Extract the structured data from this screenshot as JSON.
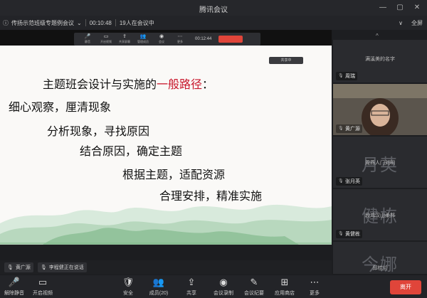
{
  "window": {
    "title": "腾讯会议"
  },
  "infobar": {
    "meeting_name": "传扬示范班级专题例会议",
    "duration": "00:10:48",
    "participants": "19人在会议中",
    "right_items": [
      "∨",
      "全屏"
    ]
  },
  "share": {
    "toolbar": {
      "buttons": [
        "静音",
        "开启视频",
        "共享屏幕",
        "管理成员",
        "会议",
        "更多"
      ],
      "timer": "00:12:44"
    },
    "view_tag": "共享中",
    "slide_lines": [
      {
        "pre": "主题班会设计与实施的",
        "hl": "一般路径",
        "post": "："
      },
      {
        "pre": "细心观察，厘清现象",
        "hl": "",
        "post": ""
      },
      {
        "pre": "分析现象，寻找原因",
        "hl": "",
        "post": ""
      },
      {
        "pre": "结合原因，确定主题",
        "hl": "",
        "post": ""
      },
      {
        "pre": "根据主题，适配资源",
        "hl": "",
        "post": ""
      },
      {
        "pre": "合理安排，精准实施",
        "hl": "",
        "post": ""
      }
    ]
  },
  "panel": {
    "collapse_icon": "^",
    "tiles": [
      {
        "center": "满溪美的名字",
        "name": "周瑞",
        "big": ""
      },
      {
        "center": "",
        "name": "黄广源",
        "big": ""
      },
      {
        "center": "周燕人门刘明",
        "name": "张月英",
        "big": "月英"
      },
      {
        "center": "段鸿汉山柔邦",
        "name": "黄健栋",
        "big": "健栋"
      },
      {
        "center": "邱桂兰",
        "name": "",
        "big": "今娜"
      }
    ]
  },
  "status": {
    "chips": [
      "黄广源",
      "李程健正在说话"
    ]
  },
  "toolbar": {
    "items": [
      {
        "icon": "mic-icon",
        "label": "解除静音"
      },
      {
        "icon": "video-icon",
        "label": "开启视频"
      },
      {
        "icon": "security-icon",
        "label": "安全"
      },
      {
        "icon": "members-icon",
        "label": "成员(20)"
      },
      {
        "icon": "share-icon",
        "label": "共享"
      },
      {
        "icon": "record-icon",
        "label": "会议录制"
      },
      {
        "icon": "chat-icon",
        "label": "会议纪要"
      },
      {
        "icon": "apps-icon",
        "label": "应用商店"
      },
      {
        "icon": "more-icon",
        "label": "更多"
      }
    ],
    "leave_label": "离开"
  },
  "colors": {
    "leave": "#e0453a",
    "highlight": "#c8162b",
    "background": "#1c1d20"
  }
}
